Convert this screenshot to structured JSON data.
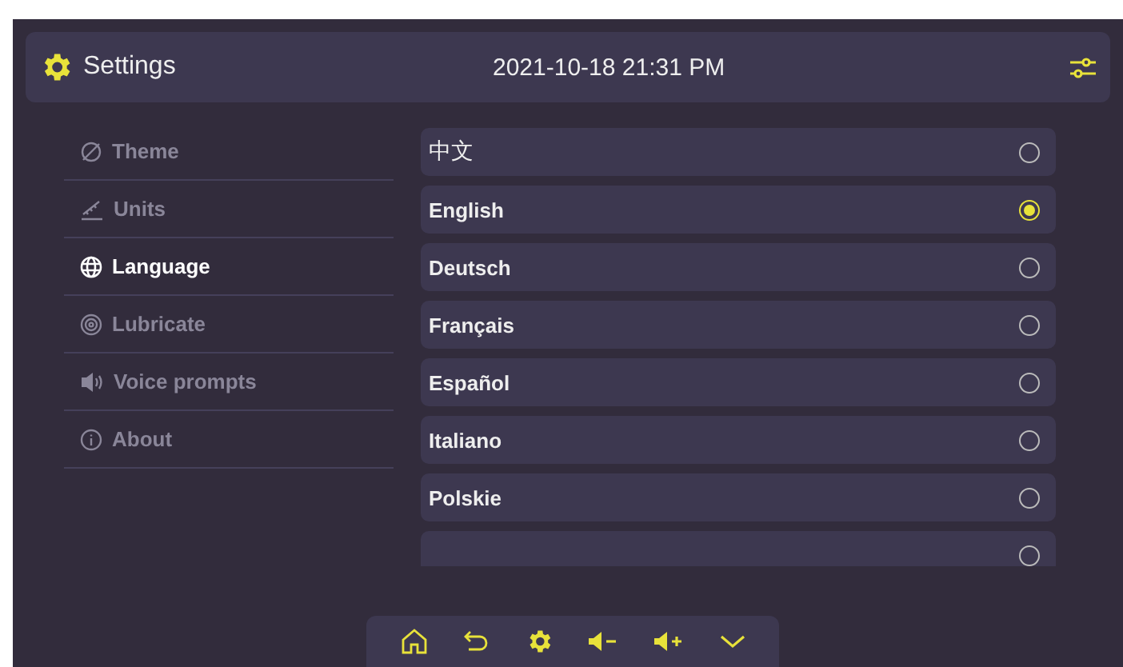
{
  "header": {
    "title": "Settings",
    "datetime": "2021-10-18 21:31 PM"
  },
  "sidebar": {
    "items": [
      {
        "kind": "theme",
        "label": "Theme",
        "selected": false
      },
      {
        "kind": "units",
        "label": "Units",
        "selected": false
      },
      {
        "kind": "language",
        "label": "Language",
        "selected": true
      },
      {
        "kind": "lubricate",
        "label": "Lubricate",
        "selected": false
      },
      {
        "kind": "voice",
        "label": "Voice prompts",
        "selected": false
      },
      {
        "kind": "about",
        "label": "About",
        "selected": false
      }
    ]
  },
  "languages": [
    {
      "label": "中文",
      "selected": false
    },
    {
      "label": "English",
      "selected": true
    },
    {
      "label": "Deutsch",
      "selected": false
    },
    {
      "label": "Français",
      "selected": false
    },
    {
      "label": "Español",
      "selected": false
    },
    {
      "label": "Italiano",
      "selected": false
    },
    {
      "label": "Polskie",
      "selected": false
    },
    {
      "selected": false
    }
  ],
  "toolbar": [
    {
      "kind": "home"
    },
    {
      "kind": "back"
    },
    {
      "kind": "settings"
    },
    {
      "kind": "volume-down"
    },
    {
      "kind": "volume-up"
    },
    {
      "kind": "collapse"
    }
  ]
}
